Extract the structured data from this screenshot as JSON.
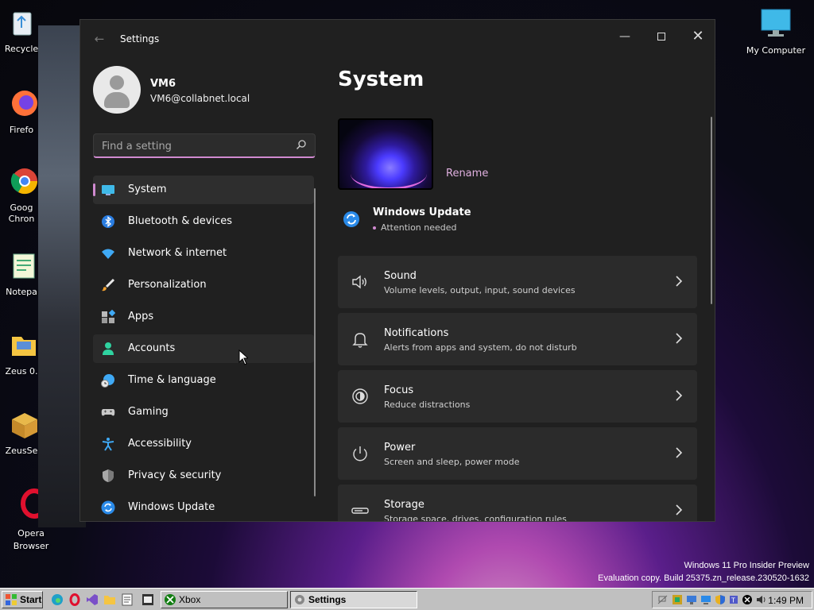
{
  "desktop": {
    "icons_left": [
      {
        "label": "Recycle",
        "icon": "recycle-bin-icon"
      },
      {
        "label": "Firefo",
        "icon": "firefox-icon"
      },
      {
        "label": "Goog\nChron",
        "icon": "chrome-icon"
      },
      {
        "label": "Notepa",
        "icon": "notepad-icon"
      },
      {
        "label": "Zeus 0.",
        "icon": "folder-icon"
      },
      {
        "label": "ZeusSe",
        "icon": "package-icon"
      },
      {
        "label": "Opera\nBrowser",
        "icon": "opera-icon"
      }
    ],
    "icon_right": {
      "label": "My Computer",
      "icon": "monitor-icon"
    },
    "watermark_line1": "Windows 11 Pro Insider Preview",
    "watermark_line2": "Evaluation copy. Build 25375.zn_release.230520-1632"
  },
  "window": {
    "title": "Settings",
    "minimize": "—",
    "close": "✕",
    "back": "←"
  },
  "profile": {
    "name": "VM6",
    "email": "VM6@collabnet.local"
  },
  "search": {
    "placeholder": "Find a setting"
  },
  "nav": [
    {
      "label": "System",
      "icon": "system-icon",
      "selected": true
    },
    {
      "label": "Bluetooth & devices",
      "icon": "bluetooth-icon"
    },
    {
      "label": "Network & internet",
      "icon": "wifi-icon"
    },
    {
      "label": "Personalization",
      "icon": "brush-icon"
    },
    {
      "label": "Apps",
      "icon": "apps-icon"
    },
    {
      "label": "Accounts",
      "icon": "accounts-icon",
      "hover": true
    },
    {
      "label": "Time & language",
      "icon": "globe-clock-icon"
    },
    {
      "label": "Gaming",
      "icon": "gamepad-icon"
    },
    {
      "label": "Accessibility",
      "icon": "accessibility-icon"
    },
    {
      "label": "Privacy & security",
      "icon": "shield-icon"
    },
    {
      "label": "Windows Update",
      "icon": "update-icon"
    }
  ],
  "main": {
    "title": "System",
    "rename": "Rename",
    "windows_update": {
      "title": "Windows Update",
      "status": "Attention needed"
    },
    "cards": [
      {
        "title": "Sound",
        "subtitle": "Volume levels, output, input, sound devices",
        "icon": "speaker-icon"
      },
      {
        "title": "Notifications",
        "subtitle": "Alerts from apps and system, do not disturb",
        "icon": "bell-icon"
      },
      {
        "title": "Focus",
        "subtitle": "Reduce distractions",
        "icon": "focus-icon"
      },
      {
        "title": "Power",
        "subtitle": "Screen and sleep, power mode",
        "icon": "power-icon"
      },
      {
        "title": "Storage",
        "subtitle": "Storage space, drives, configuration rules",
        "icon": "storage-icon"
      }
    ]
  },
  "taskbar": {
    "start": "Start",
    "buttons": [
      {
        "label": "Xbox",
        "icon": "xbox-icon"
      },
      {
        "label": "Settings",
        "icon": "gear-icon",
        "pressed": true
      }
    ],
    "clock": "1:49 PM"
  },
  "colors": {
    "accent": "#d08ad0",
    "window_bg": "#202020",
    "card_bg": "#2b2b2b",
    "taskbar_bg": "#c0c0c0"
  }
}
